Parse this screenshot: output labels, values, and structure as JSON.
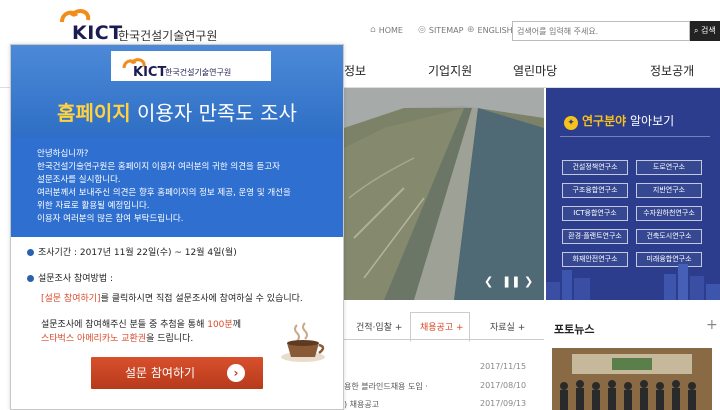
{
  "header": {
    "logo_text": "KICT",
    "logo_name": "한국건설기술연구원",
    "util": [
      {
        "icon": "home-icon",
        "label": "HOME"
      },
      {
        "icon": "sitemap-icon",
        "label": "SITEMAP"
      },
      {
        "icon": "globe-icon",
        "label": "ENGLISH"
      }
    ],
    "search_placeholder": "검색어를 입력해 주세요.",
    "search_button": "검색"
  },
  "nav": {
    "items": [
      "정보",
      "기업지원",
      "열린마당",
      "정보공개"
    ]
  },
  "research": {
    "title_highlight": "연구분야",
    "title_rest": "알아보기",
    "buttons": [
      "건설정책연구소",
      "도로연구소",
      "구조융합연구소",
      "지반연구소",
      "ICT융합연구소",
      "수자원하천연구소",
      "환경·플랜트연구소",
      "건축도시연구소",
      "화재안전연구소",
      "미래융합연구소"
    ]
  },
  "tabs": [
    "건적·입찰",
    "채용공고",
    "자료실"
  ],
  "news": [
    {
      "title": "",
      "date": "2017/11/15"
    },
    {
      "title": "용한 블라인드채용 도입 ·",
      "date": "2017/08/10"
    },
    {
      "title": ") 채용공고",
      "date": "2017/09/13"
    }
  ],
  "photo_news": {
    "title": "포토뉴스",
    "plus": "+"
  },
  "popup": {
    "logo_text": "KICT",
    "logo_name": "한국건설기술연구원",
    "title_highlight": "홈페이지",
    "title_rest": "이용자 만족도 조사",
    "intro": [
      "안녕하십니까?",
      "한국건설기술연구원은 홈페이지 이용자 여러분의 귀한 의견을 듣고자",
      "설문조사를 실시합니다.",
      "여러분께서 보내주신 의견은 향후 홈페이지의 정보 제공, 운영 및 개선을",
      "위한 자료로 활용될 예정입니다.",
      "이용자 여러분의 많은 참여 부탁드립니다."
    ],
    "period_label": "조사기간 : 2017년 11월 22일(수) ~ 12월 4일(월)",
    "method_label": "설문조사 참여방법 :",
    "method_link": "[설문 참여하기]",
    "method_rest": "를 클릭하시면 직접 설문조사에 참여하실 수 있습니다.",
    "reward_line1_a": "설문조사에 참여해주신 분들 중 추첨을 통해 ",
    "reward_line1_b": "100분",
    "reward_line1_c": "께",
    "reward_line2_a": "스타벅스 아메리카노 교환권",
    "reward_line2_b": "을 드립니다.",
    "cta": "설문 참여하기",
    "cta_icon": "chevron-right-icon"
  },
  "colors": {
    "popup_blue": "#2f6fd0",
    "highlight_yellow": "#ffd23e",
    "accent_orange": "#d84a2a",
    "research_navy": "#2b3d8c"
  }
}
